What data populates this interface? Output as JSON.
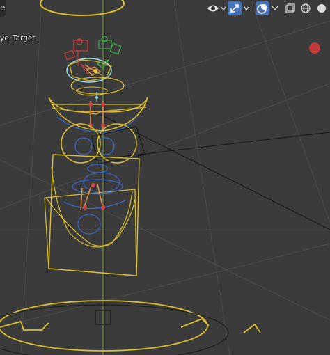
{
  "viewport": {
    "partial_tab_text": "e",
    "object_label": "ye_Target",
    "accent_color": "#4772b3",
    "wire_color": "#dcc02c",
    "bone_color": "#3a66c8"
  },
  "header": {
    "visibility_icon": "eye-icon",
    "gizmo_icon": "gizmo-arrows-icon",
    "overlay_icon": "overlays-icon",
    "xray_icon": "xray-icon",
    "shading_wire_icon": "wireframe-sphere-icon",
    "shading_solid_icon": "solid-sphere-icon"
  },
  "record_button": {
    "icon": "record-icon",
    "color": "#c23a3a"
  }
}
